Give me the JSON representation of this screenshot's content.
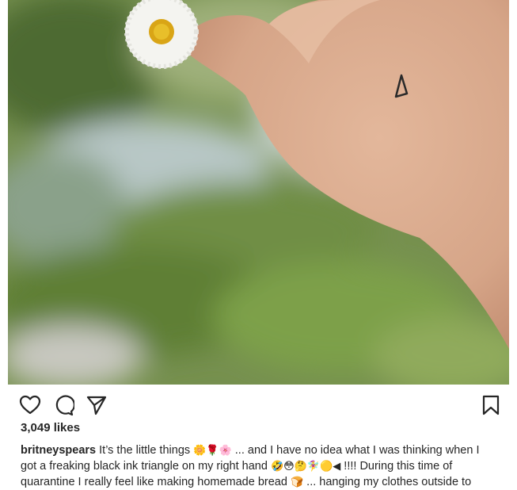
{
  "post": {
    "username": "britneyspears",
    "likes": "3,049 likes",
    "caption": {
      "line1_a": "It’s the little things",
      "line1_emojis": "🌼🌹🌸",
      "line1_b": "... and I have no idea what I was thinking when I",
      "line2_a": "got a freaking black ink triangle on my right hand",
      "line2_emojis": "🤣😳🤔🧚‍♀️🟡◀",
      "line2_b": "!!!! During this time of",
      "line3_a": "quarantine I really feel like making homemade bread",
      "line3_emoji": "🍞",
      "line3_b": "... hanging my clothes outside to"
    }
  },
  "icons": {
    "like": "heart-icon",
    "comment": "comment-bubble-icon",
    "share": "paper-plane-icon",
    "save": "bookmark-icon"
  }
}
